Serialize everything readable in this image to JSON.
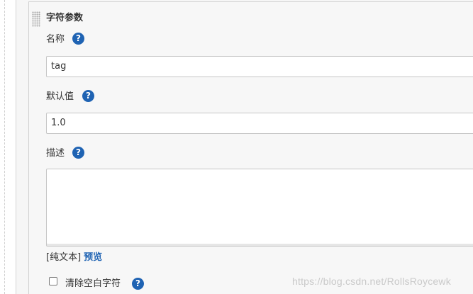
{
  "section": {
    "title": "字符参数"
  },
  "fields": {
    "name": {
      "label": "名称",
      "value": "tag",
      "help_icon": "question-circle-icon"
    },
    "default_value": {
      "label": "默认值",
      "value": "1.0",
      "help_icon": "question-circle-icon"
    },
    "description": {
      "label": "描述",
      "value": "",
      "help_icon": "question-circle-icon"
    }
  },
  "description_format": {
    "plain_text": "[纯文本]",
    "preview_link": "预览"
  },
  "trim_option": {
    "label": "清除空白字符",
    "checked": false,
    "help_icon": "question-circle-icon"
  },
  "help_glyph": "?",
  "watermark": "https://blog.csdn.net/RollsRoycewk",
  "colors": {
    "accent": "#1f63b3",
    "panel_bg": "#f7f7f7",
    "border": "#c6c6c6"
  }
}
